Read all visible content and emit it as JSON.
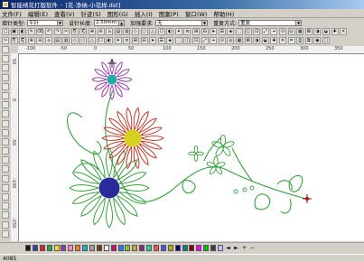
{
  "window": {
    "app_name": "智能绣花打版软件",
    "doc_title": "[花-净纳-小花样.dst]"
  },
  "menu": [
    "文件(F)",
    "编辑(E)",
    "查看(V)",
    "针迹(S)",
    "图形(G)",
    "插入(I)",
    "图案(P)",
    "窗口(W)",
    "帮助(H)"
  ],
  "props": {
    "fill_type_label": "填针类型:",
    "fill_type_value": "平针",
    "stitch_length_label": "设针长度:",
    "stitch_length_value": "2.50mm",
    "density_label": "加强要求:",
    "density_value": "无",
    "overlap_label": "重复方式:",
    "overlap_value": "重复"
  },
  "ruler": {
    "top_labels": [
      "-100",
      "-50",
      "0",
      "50",
      "100",
      "150",
      "200",
      "250",
      "300",
      "350"
    ],
    "left_labels": [
      "50",
      "0",
      "-50",
      "-100",
      "-150"
    ]
  },
  "palette": {
    "colors": [
      "#1a1a1a",
      "#2f3fa8",
      "#e0221f",
      "#1ea84a",
      "#f0e020",
      "#8b3fa8",
      "#ff8ac0",
      "#f08020",
      "#20b0d0",
      "#a0a0a0",
      "#6a3a1a",
      "#ffffff",
      "#c01070",
      "#3070ff",
      "#70d030",
      "#d0a030",
      "#803080",
      "#20d0a0",
      "#ff5050",
      "#5050ff",
      "#b0b000",
      "#000080",
      "#008080",
      "#800000",
      "#ff00ff",
      "#00c000",
      "#404040",
      "#c0c0ff"
    ],
    "prev": "◄",
    "next": "►",
    "add": "+",
    "remove": "−"
  },
  "status": {
    "text": "4085"
  },
  "design": {
    "thread_colors": {
      "top_flower_petals": "#9b3fa8",
      "top_flower_center": "#2aa8a8",
      "mid_flower_petals": "#c0392b",
      "mid_flower_center": "#d8d020",
      "big_flower_petals": "#3aa040",
      "big_flower_center": "#2a2a9a",
      "stems": "#3aa040"
    }
  }
}
